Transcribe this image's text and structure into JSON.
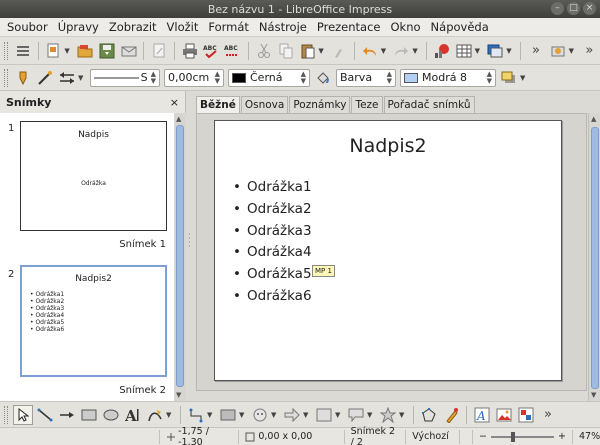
{
  "window": {
    "title": "Bez názvu 1 - LibreOffice Impress",
    "minimize": "–",
    "maximize": "□",
    "close": "×"
  },
  "menu": [
    "Soubor",
    "Úpravy",
    "Zobrazit",
    "Vložit",
    "Formát",
    "Nástroje",
    "Prezentace",
    "Okno",
    "Nápověda"
  ],
  "line_toolbar": {
    "line_style_value": "S",
    "line_width": "0,00cm",
    "line_color": "Černá",
    "line_color_hex": "#000000",
    "area_style": "Barva",
    "area_color": "Modrá 8",
    "area_color_hex": "#b4cff3"
  },
  "slides_panel": {
    "title": "Snímky",
    "close": "×",
    "slides": [
      {
        "number": "1",
        "title": "Nadpis",
        "body": "Odrážka",
        "label": "Snímek 1"
      },
      {
        "number": "2",
        "title": "Nadpis2",
        "bullets": [
          "Odrážka1",
          "Odrážka2",
          "Odrážka3",
          "Odrážka4",
          "Odrážka5",
          "Odrážka6"
        ],
        "label": "Snímek 2"
      }
    ]
  },
  "view_tabs": [
    "Běžné",
    "Osnova",
    "Poznámky",
    "Teze",
    "Pořadač snímků"
  ],
  "active_tab": "Běžné",
  "slide": {
    "title": "Nadpis2",
    "bullets": [
      "Odrážka1",
      "Odrážka2",
      "Odrážka3",
      "Odrážka4",
      "Odrážka5",
      "Odrážka6"
    ],
    "comment_tag": "MP 1"
  },
  "status": {
    "position": "-1,75 / -1,30",
    "size": "0,00 x 0,00",
    "slide": "Snímek 2 / 2",
    "layout": "Výchozí",
    "zoom_minus": "−",
    "zoom_plus": "+",
    "zoom": "47%"
  }
}
